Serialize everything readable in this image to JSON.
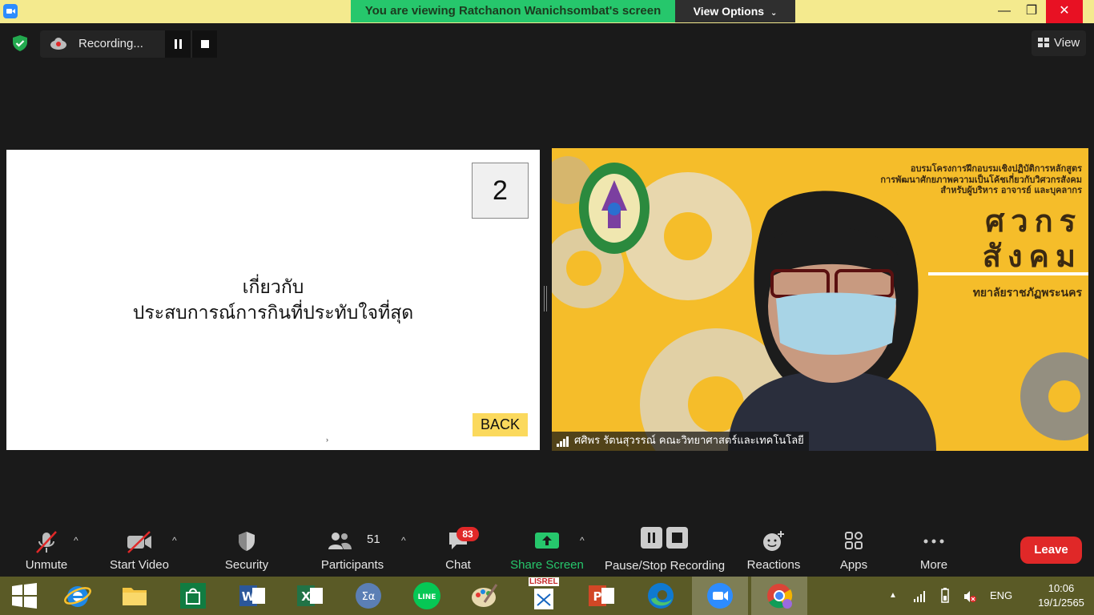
{
  "titlebar": {
    "banner": "You are viewing Ratchanon Wanichsombat's screen",
    "view_options": "View Options",
    "minimize": "—",
    "maximize": "❐",
    "close": "✕"
  },
  "meeting_top": {
    "recording_label": "Recording...",
    "view_label": "View"
  },
  "slide": {
    "number": "2",
    "line1": "เกี่ยวกับ",
    "line2": "ประสบการณ์การกินที่ประทับใจที่สุด",
    "back_label": "BACK",
    "cursor": "›"
  },
  "video": {
    "participant_name": "ศศิพร รัตนสุวรรณ์ คณะวิทยาศาสตร์และเทคโนโลยี",
    "banner_line1": "อบรมโครงการฝึกอบรมเชิงปฏิบัติการหลักสูตร",
    "banner_line2": "การพัฒนาศักยภาพความเป็นโค้ชเกี่ยวกับวิศวกรสังคม",
    "banner_line3": "สำหรับผู้บริหาร อาจารย์ และบุคลากร",
    "banner_big1": "ศวกร",
    "banner_big2": "สังคม",
    "banner_uni": "ทยาลัยราชภัฏพระนคร"
  },
  "toolbar": {
    "unmute": "Unmute",
    "start_video": "Start Video",
    "security": "Security",
    "participants": "Participants",
    "participants_count": "51",
    "chat": "Chat",
    "chat_badge": "83",
    "share_screen": "Share Screen",
    "pause_stop_recording": "Pause/Stop Recording",
    "reactions": "Reactions",
    "apps": "Apps",
    "more": "More",
    "leave": "Leave",
    "caret": "^"
  },
  "taskbar": {
    "lang": "ENG",
    "time": "10:06",
    "date": "19/1/2565",
    "lisrel_label": "LISREL"
  },
  "colors": {
    "titlebar_bg": "#f4ea8e",
    "banner_green": "#26c76c",
    "leave_red": "#e02828",
    "share_green": "#26c76c",
    "slide_back_yellow": "#fbd95d",
    "video_yellow": "#f5bd2a",
    "taskbar_bg": "#5a5a26"
  }
}
